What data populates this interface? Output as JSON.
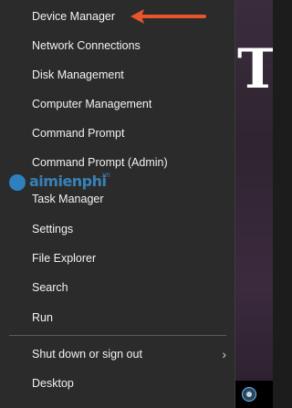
{
  "desktop": {
    "big_letter": "T"
  },
  "menu": {
    "items": [
      {
        "label": "Device Manager"
      },
      {
        "label": "Network Connections"
      },
      {
        "label": "Disk Management"
      },
      {
        "label": "Computer Management"
      },
      {
        "label": "Command Prompt"
      },
      {
        "label": "Command Prompt (Admin)"
      },
      {
        "label": "Task Manager"
      },
      {
        "label": "Settings"
      },
      {
        "label": "File Explorer"
      },
      {
        "label": "Search"
      },
      {
        "label": "Run"
      },
      {
        "label": "Shut down or sign out"
      },
      {
        "label": "Desktop"
      }
    ],
    "submenu_chevron": "›"
  },
  "annotation": {
    "arrow_color": "#e8542c",
    "points_to": "Device Manager"
  },
  "watermark": {
    "text": "aimienphi",
    "suffix": ".vn"
  },
  "colors": {
    "menu_bg": "#2b2b2b",
    "menu_text": "#f2f2f2",
    "separator": "#5a5a5a",
    "watermark": "#3aa0e8"
  }
}
